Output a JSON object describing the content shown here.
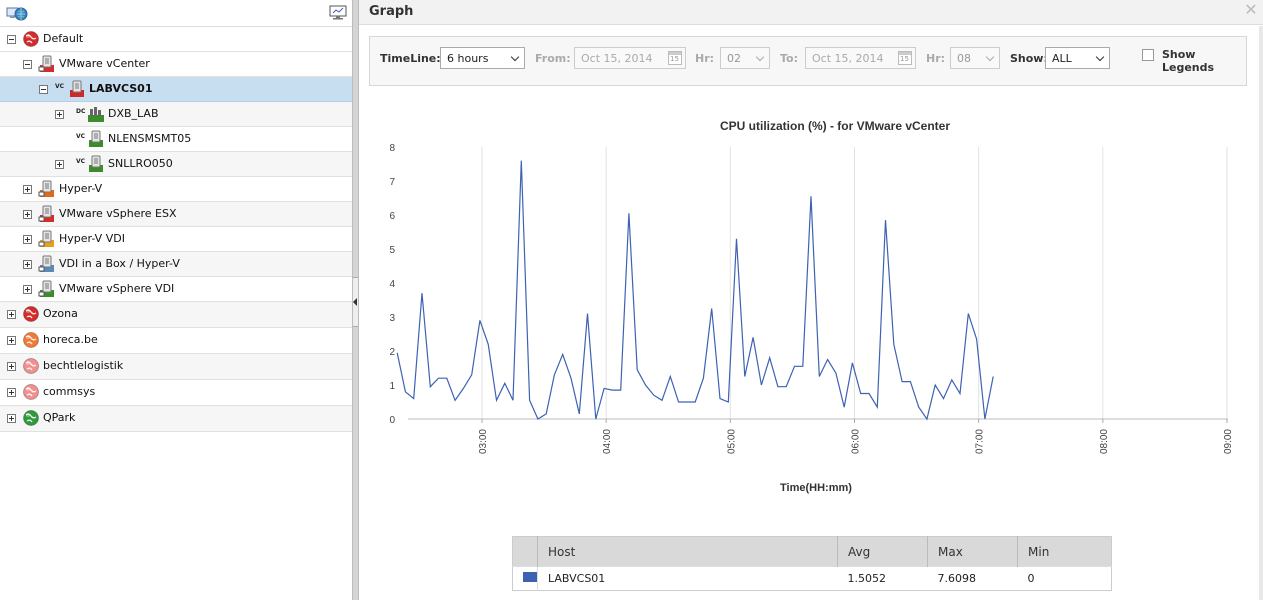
{
  "left": {
    "toolbar": {
      "icons": [
        "network-globe-icon",
        "monitor-icon"
      ]
    },
    "tree": [
      {
        "label": "Default",
        "toggle": "minus",
        "icon": "red-globe-icon",
        "color": "#d42b2b",
        "tag": ""
      },
      {
        "label": "VMware vCenter",
        "toggle": "minus",
        "icon": "vcenter-server-icon",
        "color": "#d42b2b",
        "tag": ""
      },
      {
        "label": "LABVCS01",
        "toggle": "minus",
        "icon": "server-icon",
        "color": "#cc2a2a",
        "tag": "VC",
        "selected": true
      },
      {
        "label": "DXB_LAB",
        "toggle": "plus",
        "icon": "datacenter-icon",
        "color": "#3d8c2c",
        "tag": "DC"
      },
      {
        "label": "NLENSMSMT05",
        "toggle": "",
        "icon": "server-icon",
        "color": "#3d8c2c",
        "tag": "VC"
      },
      {
        "label": "SNLLRO050",
        "toggle": "plus",
        "icon": "server-icon",
        "color": "#3d8c2c",
        "tag": "VC"
      },
      {
        "label": "Hyper-V",
        "toggle": "plus",
        "icon": "hyperv-server-icon",
        "color": "#e06a1c",
        "tag": ""
      },
      {
        "label": "VMware vSphere ESX",
        "toggle": "plus",
        "icon": "esx-server-icon",
        "color": "#d42b2b",
        "tag": ""
      },
      {
        "label": "Hyper-V VDI",
        "toggle": "plus",
        "icon": "vdi-server-icon",
        "color": "#e6a01c",
        "tag": ""
      },
      {
        "label": "VDI in a Box / Hyper-V",
        "toggle": "plus",
        "icon": "vdi-box-server-icon",
        "color": "#5a8ab8",
        "tag": ""
      },
      {
        "label": "VMware vSphere VDI",
        "toggle": "plus",
        "icon": "vsphere-vdi-server-icon",
        "color": "#3d8c2c",
        "tag": ""
      },
      {
        "label": "Ozona",
        "toggle": "plus",
        "icon": "red-globe-icon",
        "color": "#d42b2b",
        "tag": ""
      },
      {
        "label": "horeca.be",
        "toggle": "plus",
        "icon": "orange-globe-icon",
        "color": "#f07b35",
        "tag": ""
      },
      {
        "label": "bechtlelogistik",
        "toggle": "plus",
        "icon": "pink-globe-icon",
        "color": "#f09090",
        "tag": ""
      },
      {
        "label": "commsys",
        "toggle": "plus",
        "icon": "pink-globe-icon",
        "color": "#f09090",
        "tag": ""
      },
      {
        "label": "QPark",
        "toggle": "plus",
        "icon": "green-globe-icon",
        "color": "#2e9a3b",
        "tag": ""
      }
    ]
  },
  "right": {
    "title": "Graph",
    "close_icon": "close-icon",
    "toolbar": {
      "timeline_label": "TimeLine:",
      "timeline_value": "6 hours",
      "from_label": "From:",
      "from_value": "Oct 15, 2014",
      "hr1_label": "Hr:",
      "hr1_value": "02",
      "to_label": "To:",
      "to_value": "Oct 15, 2014",
      "hr2_label": "Hr:",
      "hr2_value": "08",
      "show_label": "Show:",
      "show_value": "ALL",
      "legends_label": "Show Legends",
      "calendar_day": "15"
    },
    "table": {
      "headers": [
        "",
        "Host",
        "Avg",
        "Max",
        "Min"
      ],
      "rows": [
        {
          "color": "#3d62b2",
          "host": "LABVCS01",
          "avg": "1.5052",
          "max": "7.6098",
          "min": "0"
        }
      ]
    }
  },
  "chart_data": {
    "type": "line",
    "title": "CPU utilization (%) - for VMware vCenter",
    "xlabel": "Time(HH:mm)",
    "ylabel": "",
    "ylim": [
      0,
      8
    ],
    "yticks": [
      "0",
      "1",
      "2",
      "3",
      "4",
      "5",
      "6",
      "7",
      "8"
    ],
    "xlim": [
      "02:30",
      "09:00"
    ],
    "xticks": [
      "03:00",
      "04:00",
      "05:00",
      "06:00",
      "07:00",
      "08:00",
      "09:00"
    ],
    "grid": "vertical",
    "color": "#3d62b2",
    "series": [
      {
        "points": [
          [
            "02:19",
            1.95
          ],
          [
            "02:23",
            0.8
          ],
          [
            "02:27",
            0.6
          ],
          [
            "02:31",
            3.7
          ],
          [
            "02:35",
            0.95
          ],
          [
            "02:39",
            1.2
          ],
          [
            "02:43",
            1.2
          ],
          [
            "02:47",
            0.55
          ],
          [
            "02:51",
            0.9
          ],
          [
            "02:55",
            1.3
          ],
          [
            "02:59",
            2.9
          ],
          [
            "03:03",
            2.2
          ],
          [
            "03:07",
            0.55
          ],
          [
            "03:11",
            1.05
          ],
          [
            "03:15",
            0.55
          ],
          [
            "03:19",
            7.6
          ],
          [
            "03:23",
            0.55
          ],
          [
            "03:27",
            0.0
          ],
          [
            "03:31",
            0.15
          ],
          [
            "03:35",
            1.3
          ],
          [
            "03:39",
            1.9
          ],
          [
            "03:43",
            1.2
          ],
          [
            "03:47",
            0.15
          ],
          [
            "03:51",
            3.1
          ],
          [
            "03:55",
            0.0
          ],
          [
            "03:59",
            0.9
          ],
          [
            "04:03",
            0.85
          ],
          [
            "04:07",
            0.85
          ],
          [
            "04:11",
            6.05
          ],
          [
            "04:15",
            1.45
          ],
          [
            "04:19",
            1.0
          ],
          [
            "04:23",
            0.7
          ],
          [
            "04:27",
            0.55
          ],
          [
            "04:31",
            1.25
          ],
          [
            "04:35",
            0.5
          ],
          [
            "04:39",
            0.5
          ],
          [
            "04:43",
            0.5
          ],
          [
            "04:47",
            1.2
          ],
          [
            "04:51",
            3.25
          ],
          [
            "04:55",
            0.6
          ],
          [
            "04:59",
            0.5
          ],
          [
            "05:03",
            5.3
          ],
          [
            "05:07",
            1.25
          ],
          [
            "05:11",
            2.4
          ],
          [
            "05:15",
            1.0
          ],
          [
            "05:19",
            1.8
          ],
          [
            "05:23",
            0.95
          ],
          [
            "05:27",
            0.95
          ],
          [
            "05:31",
            1.55
          ],
          [
            "05:35",
            1.55
          ],
          [
            "05:39",
            6.55
          ],
          [
            "05:43",
            1.25
          ],
          [
            "05:47",
            1.75
          ],
          [
            "05:51",
            1.35
          ],
          [
            "05:55",
            0.35
          ],
          [
            "05:59",
            1.65
          ],
          [
            "06:03",
            0.75
          ],
          [
            "06:07",
            0.75
          ],
          [
            "06:11",
            0.35
          ],
          [
            "06:15",
            5.85
          ],
          [
            "06:19",
            2.2
          ],
          [
            "06:23",
            1.1
          ],
          [
            "06:27",
            1.1
          ],
          [
            "06:31",
            0.35
          ],
          [
            "06:35",
            0.0
          ],
          [
            "06:39",
            1.0
          ],
          [
            "06:43",
            0.6
          ],
          [
            "06:47",
            1.15
          ],
          [
            "06:51",
            0.75
          ],
          [
            "06:55",
            3.1
          ],
          [
            "06:59",
            2.35
          ],
          [
            "07:03",
            0.0
          ],
          [
            "07:07",
            1.25
          ]
        ]
      }
    ]
  }
}
